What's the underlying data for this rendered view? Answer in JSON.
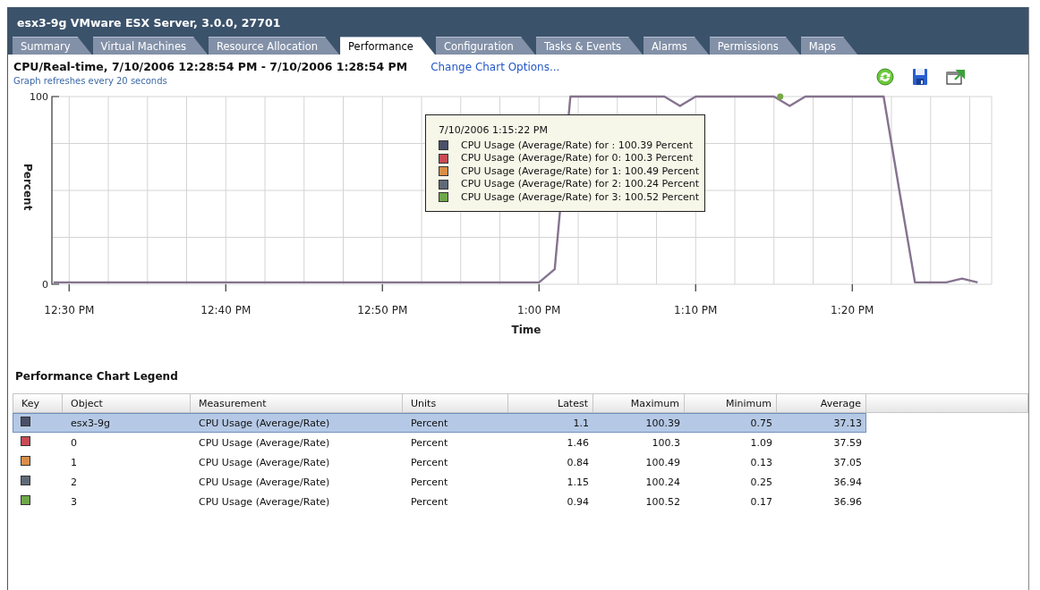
{
  "window": {
    "title": "esx3-9g  VMware ESX Server, 3.0.0, 27701"
  },
  "tabs": [
    {
      "label": "Summary",
      "selected": false
    },
    {
      "label": "Virtual Machines",
      "selected": false
    },
    {
      "label": "Resource Allocation",
      "selected": false
    },
    {
      "label": "Performance",
      "selected": true
    },
    {
      "label": "Configuration",
      "selected": false
    },
    {
      "label": "Tasks & Events",
      "selected": false
    },
    {
      "label": "Alarms",
      "selected": false
    },
    {
      "label": "Permissions",
      "selected": false
    },
    {
      "label": "Maps",
      "selected": false
    }
  ],
  "chart_header": {
    "title": "CPU/Real-time, 7/10/2006 12:28:54 PM - 7/10/2006 1:28:54 PM",
    "link": "Change Chart Options...",
    "subtitle": "Graph refreshes every 20 seconds"
  },
  "chart": {
    "chart_data": {
      "type": "line",
      "xlabel": "Time",
      "ylabel": "Percent",
      "categories": [
        null,
        "12:30 PM",
        null,
        null,
        null,
        null,
        null,
        null,
        null,
        null,
        null,
        "12:40 PM",
        null,
        null,
        null,
        null,
        null,
        null,
        null,
        null,
        null,
        "12:50 PM",
        null,
        null,
        null,
        null,
        null,
        null,
        null,
        null,
        null,
        "1:00 PM",
        null,
        null,
        null,
        null,
        null,
        null,
        null,
        null,
        null,
        "1:10 PM",
        null,
        null,
        null,
        null,
        null,
        null,
        null,
        null,
        null,
        "1:20 PM",
        null,
        null,
        null,
        null,
        null,
        null,
        null,
        null
      ],
      "series": [
        {
          "color": "#85738f",
          "values": [
            1,
            1,
            1,
            1,
            1,
            1,
            1,
            1,
            1,
            1,
            1,
            1,
            1,
            1,
            1,
            1,
            1,
            1,
            1,
            1,
            1,
            1,
            1,
            1,
            1,
            1,
            1,
            1,
            1,
            1,
            1,
            1,
            8,
            100,
            100,
            100,
            100,
            100,
            100,
            100,
            95,
            100,
            100,
            100,
            100,
            100,
            100,
            95,
            100,
            100,
            100,
            100,
            100,
            100,
            50,
            1,
            1,
            1,
            3,
            1
          ]
        }
      ],
      "ylim": [
        0,
        100
      ],
      "yticks": [
        0,
        100
      ],
      "grid": true
    },
    "tooltip": {
      "time": "7/10/2006 1:15:22 PM",
      "items": [
        {
          "color": "#4a5068",
          "text": "CPU Usage (Average/Rate) for : 100.39 Percent"
        },
        {
          "color": "#c84b55",
          "text": "CPU Usage (Average/Rate) for 0: 100.3 Percent"
        },
        {
          "color": "#d98e48",
          "text": "CPU Usage (Average/Rate) for 1: 100.49 Percent"
        },
        {
          "color": "#5f6a78",
          "text": "CPU Usage (Average/Rate) for 2: 100.24 Percent"
        },
        {
          "color": "#6ea84a",
          "text": "CPU Usage (Average/Rate) for 3: 100.52 Percent"
        }
      ]
    }
  },
  "legend": {
    "title": "Performance Chart Legend",
    "columns": [
      "Key",
      "Object",
      "Measurement",
      "Units",
      "Latest",
      "Maximum",
      "Minimum",
      "Average"
    ],
    "rows": [
      {
        "selected": true,
        "color": "#4a5068",
        "cells": [
          "",
          "esx3-9g",
          "CPU Usage (Average/Rate)",
          "Percent",
          "1.1",
          "100.39",
          "0.75",
          "37.13"
        ]
      },
      {
        "selected": false,
        "color": "#c84b55",
        "cells": [
          "",
          "0",
          "CPU Usage (Average/Rate)",
          "Percent",
          "1.46",
          "100.3",
          "1.09",
          "37.59"
        ]
      },
      {
        "selected": false,
        "color": "#d98e48",
        "cells": [
          "",
          "1",
          "CPU Usage (Average/Rate)",
          "Percent",
          "0.84",
          "100.49",
          "0.13",
          "37.05"
        ]
      },
      {
        "selected": false,
        "color": "#5f6a78",
        "cells": [
          "",
          "2",
          "CPU Usage (Average/Rate)",
          "Percent",
          "1.15",
          "100.24",
          "0.25",
          "36.94"
        ]
      },
      {
        "selected": false,
        "color": "#6ea84a",
        "cells": [
          "",
          "3",
          "CPU Usage (Average/Rate)",
          "Percent",
          "0.94",
          "100.52",
          "0.17",
          "36.96"
        ]
      }
    ]
  }
}
